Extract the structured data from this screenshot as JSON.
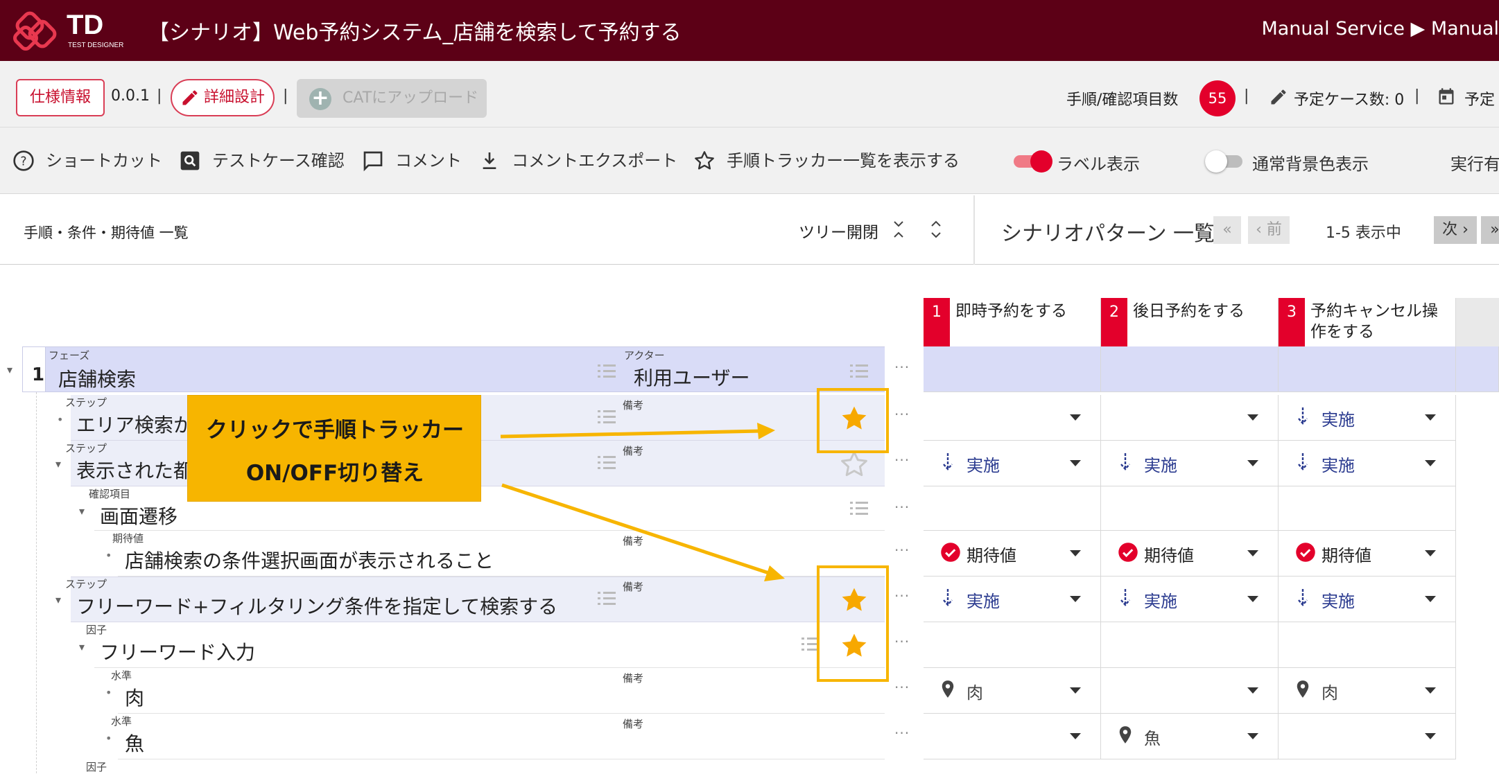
{
  "header": {
    "logo_text": "TD",
    "logo_sub": "TEST DESIGNER",
    "title": "【シナリオ】Web予約システム_店舗を検索して予約する",
    "breadcrumb": "Manual Service ▶ Manual"
  },
  "spec_toolbar": {
    "spec_button": "仕様情報",
    "version": "0.0.1",
    "separator": "|",
    "detail_design_button": "詳細設計",
    "cat_upload_button": "CATにアップロード",
    "step_count_label": "手順/確認項目数",
    "step_count_value": "55",
    "planned_cases": "予定ケース数: 0",
    "planned_more": "予定"
  },
  "action_toolbar": {
    "shortcut": "ショートカット",
    "testcase_check": "テストケース確認",
    "comment": "コメント",
    "comment_export": "コメントエクスポート",
    "step_tracker_list": "手順トラッカー一覧を表示する",
    "label_display": "ラベル表示",
    "label_display_on": true,
    "normal_bg": "通常背景色表示",
    "normal_bg_on": false,
    "running": "実行有"
  },
  "list_header": {
    "title": "手順・条件・期待値 一覧",
    "tree_toggle": "ツリー開閉",
    "scenario_title": "シナリオパターン 一覧",
    "first": "«",
    "prev": "‹ 前",
    "range": "1-5 表示中",
    "next": "次 ›",
    "last": "»"
  },
  "patterns": [
    {
      "num": "1",
      "name_line1": "即時予約をする",
      "name_line2": ""
    },
    {
      "num": "2",
      "name_line1": "後日予約をする",
      "name_line2": ""
    },
    {
      "num": "3",
      "name_line1": "予約キャンセル操",
      "name_line2": "作をする"
    }
  ],
  "labels": {
    "phase": "フェーズ",
    "actor": "アクター",
    "step": "ステップ",
    "remarks": "備考",
    "check_item": "確認項目",
    "expected": "期待値",
    "factor": "因子",
    "level": "水準",
    "more": "···"
  },
  "rows": {
    "phase": {
      "num": "1",
      "text": "店舗検索",
      "actor": "利用ユーザー"
    },
    "step1": {
      "text": "エリア検索か",
      "cells": [
        "",
        "",
        "実施"
      ]
    },
    "step2": {
      "text": "表示された都",
      "cells": [
        "実施",
        "実施",
        "実施"
      ]
    },
    "check": {
      "text": "画面遷移"
    },
    "expected": {
      "text": "店舗検索の条件選択画面が表示されること",
      "cells": [
        "期待値",
        "期待値",
        "期待値"
      ]
    },
    "step3": {
      "text": "フリーワード+フィルタリング条件を指定して検索する",
      "cells": [
        "実施",
        "実施",
        "実施"
      ]
    },
    "factor": {
      "text": "フリーワード入力"
    },
    "level1": {
      "text": "肉",
      "cells": [
        "肉",
        "",
        "肉"
      ]
    },
    "level2": {
      "text": "魚",
      "cells": [
        "",
        "魚",
        ""
      ]
    }
  },
  "callout": {
    "line1": "クリックで手順トラッカー",
    "line2": "ON/OFF切り替え"
  },
  "colors": {
    "topbar": "#5c0016",
    "accent_red": "#e3002b",
    "star_on": "#f7a800",
    "callout": "#f7b500",
    "phase_bg": "#d9dcf7",
    "step_bg": "#eceef8",
    "action_blue": "#2a3a8f"
  }
}
